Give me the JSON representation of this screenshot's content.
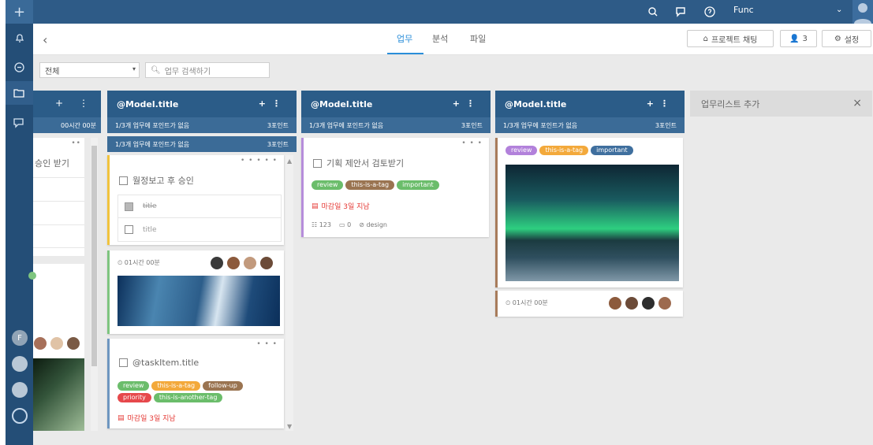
{
  "sidebar": {
    "logo_icon": "plus-icon",
    "items": [
      {
        "icon": "bell-icon"
      },
      {
        "icon": "compass-icon"
      },
      {
        "icon": "folder-icon"
      },
      {
        "icon": "chat-icon"
      }
    ],
    "users": [
      {
        "initial": "F"
      },
      {
        "initial": ""
      },
      {
        "initial": ""
      },
      {
        "initial": ""
      }
    ]
  },
  "topbar": {
    "username": "Func"
  },
  "subbar": {
    "tabs": [
      "업무",
      "분석",
      "파일"
    ],
    "active_tab": 0,
    "project_chat_label": "프로젝트 채팅",
    "members_count": "3",
    "settings_label": "설정"
  },
  "filters": {
    "select_value": "전체",
    "search_placeholder": "업무 검색하기"
  },
  "columns": [
    {
      "title": "",
      "subheader_left": "00시간 00분",
      "card_title": "승인 받기"
    },
    {
      "title": "@Model.title",
      "subheader_left": "1/3개 업무에 포인트가 없음",
      "subheader_right": "3포인트",
      "subheader2_left": "1/3개 업무에 포인트가 없음",
      "subheader2_right": "3포인트",
      "cards": [
        {
          "title": "월정보고 후 승인",
          "checklist": [
            {
              "label": "title",
              "checked": true
            },
            {
              "label": "title",
              "checked": false
            }
          ]
        },
        {
          "time": "01시간 00분"
        },
        {
          "title": "@taskItem.title",
          "tags": [
            "review",
            "this-is-a-tag",
            "follow-up",
            "priority",
            "this-is-another-tag"
          ],
          "deadline": "마감일 3일 지남"
        }
      ]
    },
    {
      "title": "@Model.title",
      "subheader_left": "1/3개 업무에 포인트가 없음",
      "subheader_right": "3포인트",
      "cards": [
        {
          "title": "기획 제안서 검토받기",
          "tags": [
            "review",
            "this-is-a-tag",
            "important"
          ],
          "deadline": "마감일 3일 지남",
          "meta": [
            "123",
            "0",
            "design"
          ]
        }
      ]
    },
    {
      "title": "@Model.title",
      "subheader_left": "1/3개 업무에 포인트가 없음",
      "subheader_right": "3포인트",
      "cards": [
        {
          "tags": [
            "review",
            "this-is-a-tag",
            "important"
          ],
          "time": "01시간 00분"
        }
      ]
    }
  ],
  "add_list_label": "업무리스트 추가",
  "colors": {
    "topbar": "#2e5b87",
    "accent": "#2a8ed9"
  }
}
